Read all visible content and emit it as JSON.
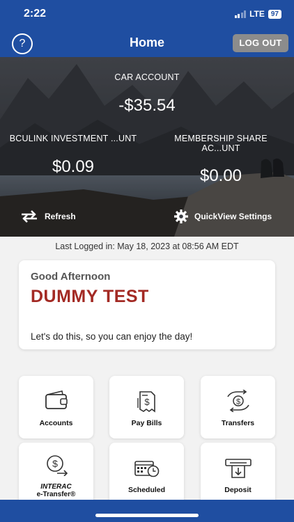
{
  "status": {
    "time": "2:22",
    "network": "LTE",
    "battery": "97"
  },
  "nav": {
    "help": "?",
    "title": "Home",
    "logout": "LOG OUT"
  },
  "accounts": {
    "main": {
      "label": "CAR ACCOUNT",
      "value": "-$35.54"
    },
    "left": {
      "label": "BCULINK INVESTMENT ...UNT",
      "value": "$0.09"
    },
    "right": {
      "label_line1": "MEMBERSHIP SHARE",
      "label_line2": "AC...UNT",
      "value": "$0.00"
    }
  },
  "actions": {
    "refresh": "Refresh",
    "settings": "QuickView Settings"
  },
  "last_logged": "Last Logged in: May 18, 2023 at 08:56 AM  EDT",
  "greeting": {
    "salutation": "Good Afternoon",
    "name": "DUMMY TEST",
    "message": "Let's do this, so you can enjoy the day!"
  },
  "tiles": [
    {
      "label": "Accounts",
      "icon": "wallet-icon"
    },
    {
      "label": "Pay Bills",
      "icon": "bill-icon"
    },
    {
      "label": "Transfers",
      "icon": "transfer-icon"
    },
    {
      "label_line1": "INTERAC",
      "label_line2": "e-Transfer®",
      "icon": "etransfer-icon"
    },
    {
      "label": "Scheduled",
      "icon": "calendar-clock-icon"
    },
    {
      "label": "Deposit",
      "icon": "atm-deposit-icon"
    }
  ],
  "colors": {
    "brand_blue": "#1f4ea1",
    "name_red": "#a32a24"
  }
}
